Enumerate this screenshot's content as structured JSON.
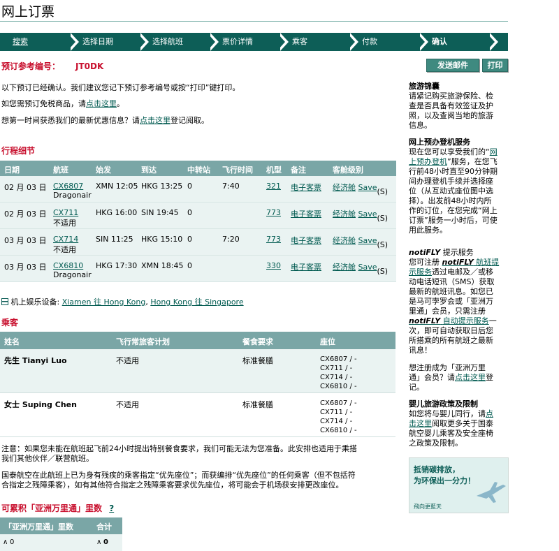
{
  "page": {
    "title": "网上订票"
  },
  "steps": [
    {
      "label": "搜索"
    },
    {
      "label": "选择日期"
    },
    {
      "label": "选择航班"
    },
    {
      "label": "票价详情"
    },
    {
      "label": "乘客"
    },
    {
      "label": "付款"
    },
    {
      "label": "确认"
    }
  ],
  "booking": {
    "ref_label": "预订参考编号：",
    "ref_code": "JT0DK",
    "email_button": "发送邮件",
    "print_button": "打印"
  },
  "intro": {
    "line1": "以下预订已经确认。我们建议您记下预订参考编号或按“打印”键打印。",
    "line2_prefix": "如您需预订免税商品，请",
    "line2_link": "点击这里",
    "line2_suffix": "。",
    "line3_prefix": "想第一时间获悉我们的最新优惠信息？请",
    "line3_link": "点击这里",
    "line3_suffix": "登记阅取。"
  },
  "itinerary": {
    "title": "行程细节",
    "headers": [
      "日期",
      "航班",
      "始发",
      "到达",
      "中转站",
      "飞行时间",
      "机型",
      "备注",
      "客舱级别"
    ],
    "rows": [
      {
        "date": "02 月 03 日",
        "flight": "CX6807",
        "note": "Dragonair",
        "from": "XMN 12:05",
        "to": "HKG 13:25",
        "stops": "0",
        "duration": "7:40",
        "aircraft": "321",
        "remark": "电子客票",
        "cabin": "经济舱",
        "save": "Save",
        "class": "(S)"
      },
      {
        "date": "02 月 03 日",
        "flight": "CX711",
        "note": "不适用",
        "from": "HKG 16:00",
        "to": "SIN 19:45",
        "stops": "0",
        "duration": "",
        "aircraft": "773",
        "remark": "电子客票",
        "cabin": "经济舱",
        "save": "Save",
        "class": "(S)"
      },
      {
        "date": "03 月 03 日",
        "flight": "CX714",
        "note": "不适用",
        "from": "SIN 11:25",
        "to": "HKG 15:10",
        "stops": "0",
        "duration": "7:20",
        "aircraft": "773",
        "remark": "电子客票",
        "cabin": "经济舱",
        "save": "Save",
        "class": "(S)"
      },
      {
        "date": "03 月 03 日",
        "flight": "CX6810",
        "note": "Dragonair",
        "from": "HKG 17:30",
        "to": "XMN 18:45",
        "stops": "0",
        "duration": "",
        "aircraft": "330",
        "remark": "电子客票",
        "cabin": "经济舱",
        "save": "Save",
        "class": "(S)"
      }
    ],
    "entertainment_label": "机上娱乐设备:",
    "entertainment_link1": "Xiamen 往 Hong Kong",
    "entertainment_sep": ",",
    "entertainment_link2": "Hong Kong 往 Singapore"
  },
  "passengers": {
    "title": "乘客",
    "headers": [
      "姓名",
      "飞行常旅客计划",
      "餐食要求",
      "座位"
    ],
    "rows": [
      {
        "name": "先生 Tianyi Luo",
        "ffp": "不适用",
        "meal": "标准餐膳",
        "seats": [
          "CX6807 / -",
          "CX711 / -",
          "CX714 / -",
          "CX6810 / -"
        ]
      },
      {
        "name": "女士 Suping Chen",
        "ffp": "不适用",
        "meal": "标准餐膳",
        "seats": [
          "CX6807 / -",
          "CX711 / -",
          "CX714 / -",
          "CX6810 / -"
        ]
      }
    ]
  },
  "notes": {
    "meal_line1": "注意：如果您未能在航班起飞前24小时提出特别餐食要求，我们可能无法为您准备。此安排也适用于乘搭",
    "meal_line2": "我们其他伙伴／联营航班。",
    "seat_line1": "国泰航空在此航班上已为身有残疾的乘客指定“优先座位”；而获编排“优先座位”的任何乘客（但不包括符",
    "seat_line2": "合指定之残障乘客），如有其他符合指定之残障乘客要求优先座位，将可能会于机场获安排更改座位。"
  },
  "miles": {
    "title": "可累积「亚洲万里通」里数",
    "help": "?",
    "headers": [
      "「亚洲万里通」里数",
      "合计"
    ],
    "values": [
      "0",
      "0"
    ]
  },
  "sidebar": {
    "travel_title": "旅游锦囊",
    "travel_text": [
      "请紧记购买旅游保险、检",
      "查是否具备有效签证及护",
      "照，以及查阅当地的旅游",
      "信息。"
    ],
    "checkin_title": "网上预办登机服务",
    "checkin_l1_prefix": "现在您可以享受我们的“",
    "checkin_l1_link": "网",
    "checkin_l2_link": "上预办登机",
    "checkin_l2_suffix": "”服务，在您飞",
    "checkin_text": [
      "行前48小时直至90分钟期",
      "间办理登机手续并选择座",
      "位（从互动式座位图中选",
      "择）。出发前48小时内所",
      "作的订位，在您完成“网上",
      "订票”服务一小时后，可使",
      "用此服务。"
    ],
    "notify_title_brand": "notiFLY",
    "notify_title_suffix": "提示服务",
    "notify_l1_prefix": "您可注册",
    "notify_l1_brand": "notiFLY",
    "notify_l1_link": "航班提",
    "notify_l2_link": "示服务",
    "notify_l2_suffix": "透过电邮及／或移",
    "notify_text1": [
      "动电话短讯（SMS）获取",
      "最新的航班讯息。如您已",
      "是马可孛罗会或「亚洲万",
      "里通」会员，只需注册"
    ],
    "notify_l7_brand": "notiFLY",
    "notify_l7_link": "自动提示服务",
    "notify_l7_suffix": "一",
    "notify_text2": [
      "次，即可自动获取日后您",
      "所搭乘的所有航班之最新",
      "讯息！"
    ],
    "member_l1": "想注册成为「亚洲万里",
    "member_l2_prefix": "通」会员？请",
    "member_l2_link": "点击这里",
    "member_l2_suffix": "登",
    "member_l3": "记。",
    "infant_title": "婴儿旅游政策及限制",
    "infant_l1_prefix": "如您将与婴儿同行，请",
    "infant_l1_link": "点",
    "infant_l2_link": "击这里",
    "infant_l2_suffix": "阅取更多关于国泰",
    "infant_text": [
      "航空婴儿乘客及安全座椅",
      "之政策及限制。"
    ],
    "banner_line1": "抵销碳排放，",
    "banner_line2": "为环保出一分力！",
    "banner_footer": "飛向更藍天"
  },
  "colors": {
    "step_bar": "#0d5e57",
    "header_bg": "#7aa6a6",
    "row_bg": "#eaf3f2",
    "accent_red": "#c8102e",
    "link": "#005a50"
  }
}
